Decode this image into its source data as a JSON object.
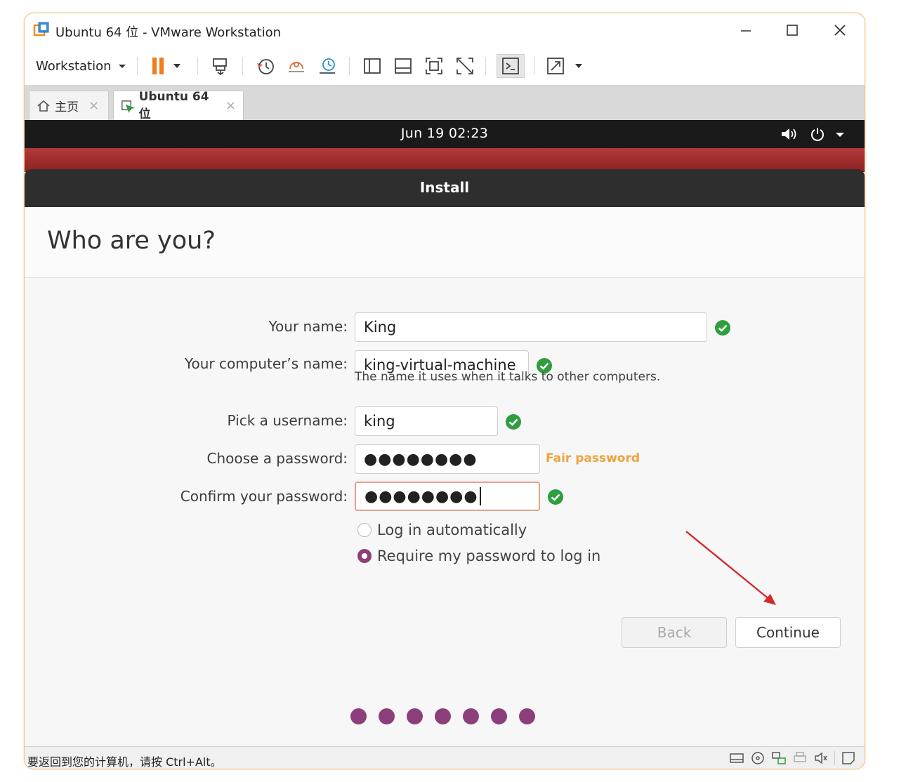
{
  "window": {
    "title": "Ubuntu 64 位 - VMware Workstation",
    "controls": {
      "minimize": "–",
      "maximize": "☐",
      "close": "✕"
    }
  },
  "toolbar": {
    "menu_label": "Workstation",
    "icons": [
      "pause-icon",
      "send-keys-icon",
      "snapshot-icon",
      "revert-snapshot-icon",
      "snapshot-manager-icon",
      "library-icon",
      "thumbnail-bar-icon",
      "full-screen-icon",
      "unity-icon",
      "console-icon",
      "stretch-icon"
    ]
  },
  "tabs": [
    {
      "label": "主页",
      "close": "×",
      "icon": "home-icon"
    },
    {
      "label": "Ubuntu 64 位",
      "close": "×",
      "icon": "vm-icon",
      "active": true
    }
  ],
  "guest": {
    "clock": "Jun 19  02:23",
    "install_title": "Install",
    "heading": "Who are you?",
    "form": {
      "name_label": "Your name:",
      "name_value": "King",
      "computer_label": "Your computer’s name:",
      "computer_value": "king-virtual-machine",
      "computer_hint": "The name it uses when it talks to other computers.",
      "username_label": "Pick a username:",
      "username_value": "king",
      "password_label": "Choose a password:",
      "password_value": "●●●●●●●●",
      "password_strength": "Fair password",
      "confirm_label": "Confirm your password:",
      "confirm_value": "●●●●●●●●",
      "login_auto_label": "Log in automatically",
      "require_password_label": "Require my password to log in"
    },
    "buttons": {
      "back": "Back",
      "continue": "Continue"
    },
    "progress_steps": 7
  },
  "status_bar": {
    "text": "要返回到您的计算机，请按 Ctrl+Alt。"
  },
  "colors": {
    "ubuntu_purple": "#8c3f7a",
    "ok_green": "#2e9e3e",
    "strength_orange": "#f0a23c",
    "annotation_arrow": "#d42a2a"
  }
}
